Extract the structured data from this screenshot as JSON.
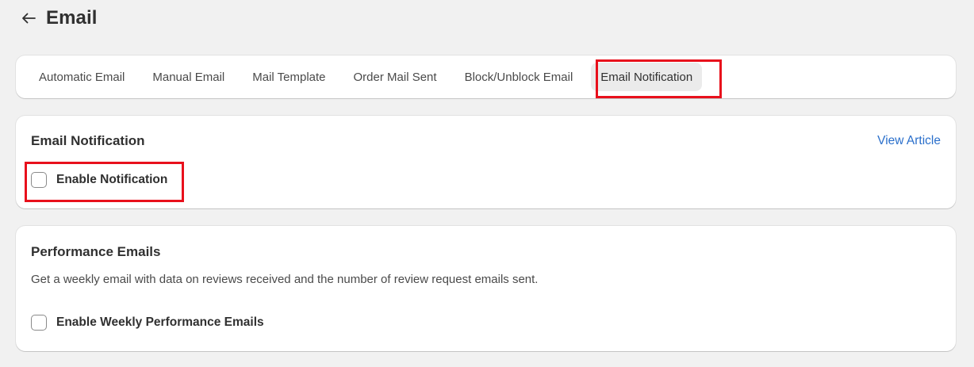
{
  "header": {
    "back_icon": "arrow-left-icon",
    "title": "Email"
  },
  "tabs": [
    {
      "label": "Automatic Email",
      "active": false
    },
    {
      "label": "Manual Email",
      "active": false
    },
    {
      "label": "Mail Template",
      "active": false
    },
    {
      "label": "Order Mail Sent",
      "active": false
    },
    {
      "label": "Block/Unblock Email",
      "active": false
    },
    {
      "label": "Email Notification",
      "active": true
    }
  ],
  "email_notification": {
    "title": "Email Notification",
    "view_article": "View Article",
    "enable_label": "Enable Notification",
    "enabled": false
  },
  "performance_emails": {
    "title": "Performance Emails",
    "description": "Get a weekly email with data on reviews received and the number of review request emails sent.",
    "enable_label": "Enable Weekly Performance Emails",
    "enabled": false
  },
  "colors": {
    "background": "#f1f1f1",
    "card": "#ffffff",
    "highlight": "#e8101c",
    "link": "#2a6fcb",
    "active_tab": "#ebebeb"
  }
}
